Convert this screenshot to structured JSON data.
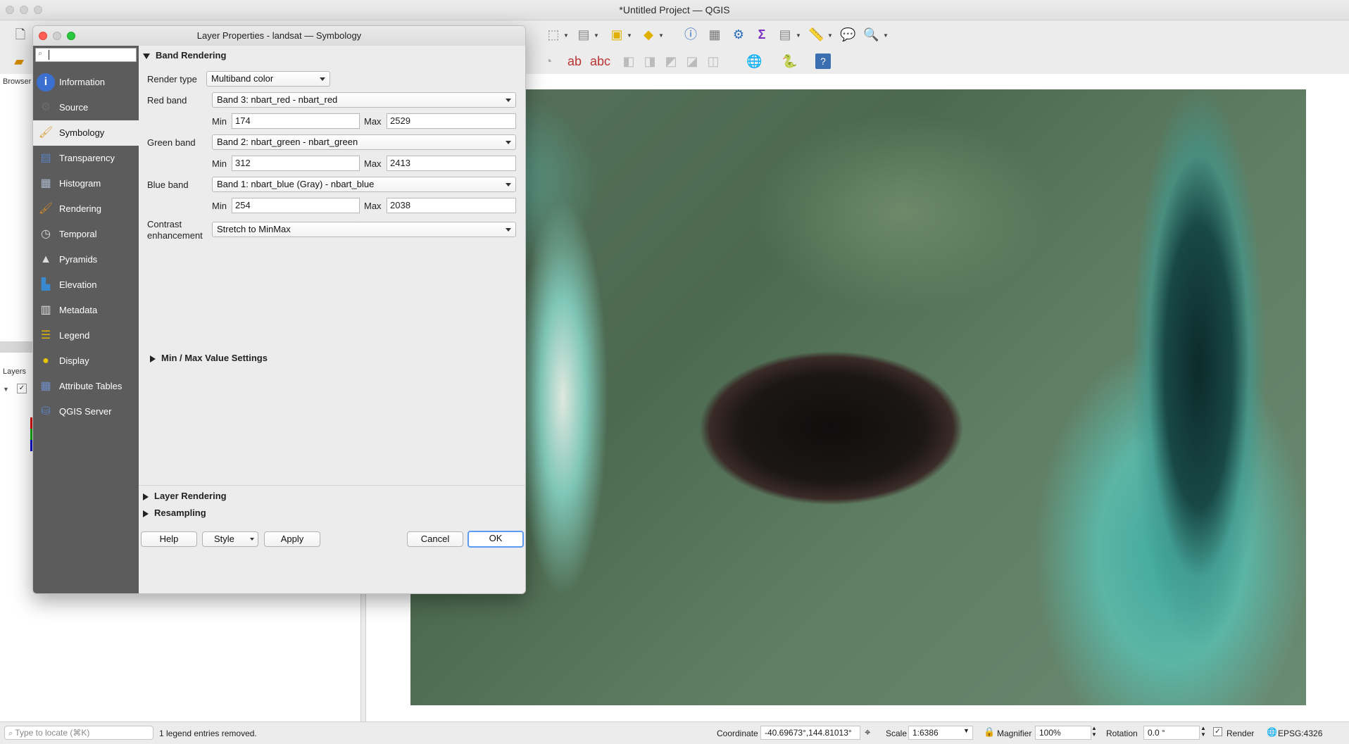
{
  "window": {
    "title": "*Untitled Project — QGIS"
  },
  "left_dock": {
    "browser_title": "Browser",
    "layers_title": "Layers"
  },
  "dialog": {
    "title": "Layer Properties - landsat — Symbology",
    "search_value": "",
    "nav_items": [
      {
        "label": "Information",
        "icon": "info-icon"
      },
      {
        "label": "Source",
        "icon": "source-icon"
      },
      {
        "label": "Symbology",
        "icon": "symbology-icon"
      },
      {
        "label": "Transparency",
        "icon": "transparency-icon"
      },
      {
        "label": "Histogram",
        "icon": "histogram-icon"
      },
      {
        "label": "Rendering",
        "icon": "rendering-icon"
      },
      {
        "label": "Temporal",
        "icon": "clock-icon"
      },
      {
        "label": "Pyramids",
        "icon": "pyramid-icon"
      },
      {
        "label": "Elevation",
        "icon": "elevation-icon"
      },
      {
        "label": "Metadata",
        "icon": "metadata-icon"
      },
      {
        "label": "Legend",
        "icon": "legend-icon"
      },
      {
        "label": "Display",
        "icon": "speech-bubble-icon"
      },
      {
        "label": "Attribute Tables",
        "icon": "table-icon"
      },
      {
        "label": "QGIS Server",
        "icon": "server-icon"
      }
    ],
    "active_nav": "Symbology",
    "band_rendering": {
      "header": "Band Rendering",
      "render_type_label": "Render type",
      "render_type_value": "Multiband color",
      "red_label": "Red band",
      "red_value": "Band 3: nbart_red - nbart_red",
      "red_min": "174",
      "red_max": "2529",
      "green_label": "Green band",
      "green_value": "Band 2: nbart_green - nbart_green",
      "green_min": "312",
      "green_max": "2413",
      "blue_label": "Blue band",
      "blue_value": "Band 1: nbart_blue (Gray) - nbart_blue",
      "blue_min": "254",
      "blue_max": "2038",
      "min_label": "Min",
      "max_label": "Max",
      "contrast_label_1": "Contrast",
      "contrast_label_2": "enhancement",
      "contrast_value": "Stretch to MinMax",
      "minmax_settings": "Min / Max Value Settings"
    },
    "layer_rendering": "Layer Rendering",
    "resampling": "Resampling",
    "buttons": {
      "help": "Help",
      "style": "Style",
      "apply": "Apply",
      "cancel": "Cancel",
      "ok": "OK"
    }
  },
  "statusbar": {
    "locate_placeholder": "Type to locate (⌘K)",
    "message": "1 legend entries removed.",
    "coordinate_label": "Coordinate",
    "coordinate_value": "-40.69673°,144.81013°",
    "scale_label": "Scale",
    "scale_value": "1:6386",
    "magnifier_label": "Magnifier",
    "magnifier_value": "100%",
    "rotation_label": "Rotation",
    "rotation_value": "0.0 °",
    "render_label": "Render",
    "crs": "EPSG:4326"
  }
}
